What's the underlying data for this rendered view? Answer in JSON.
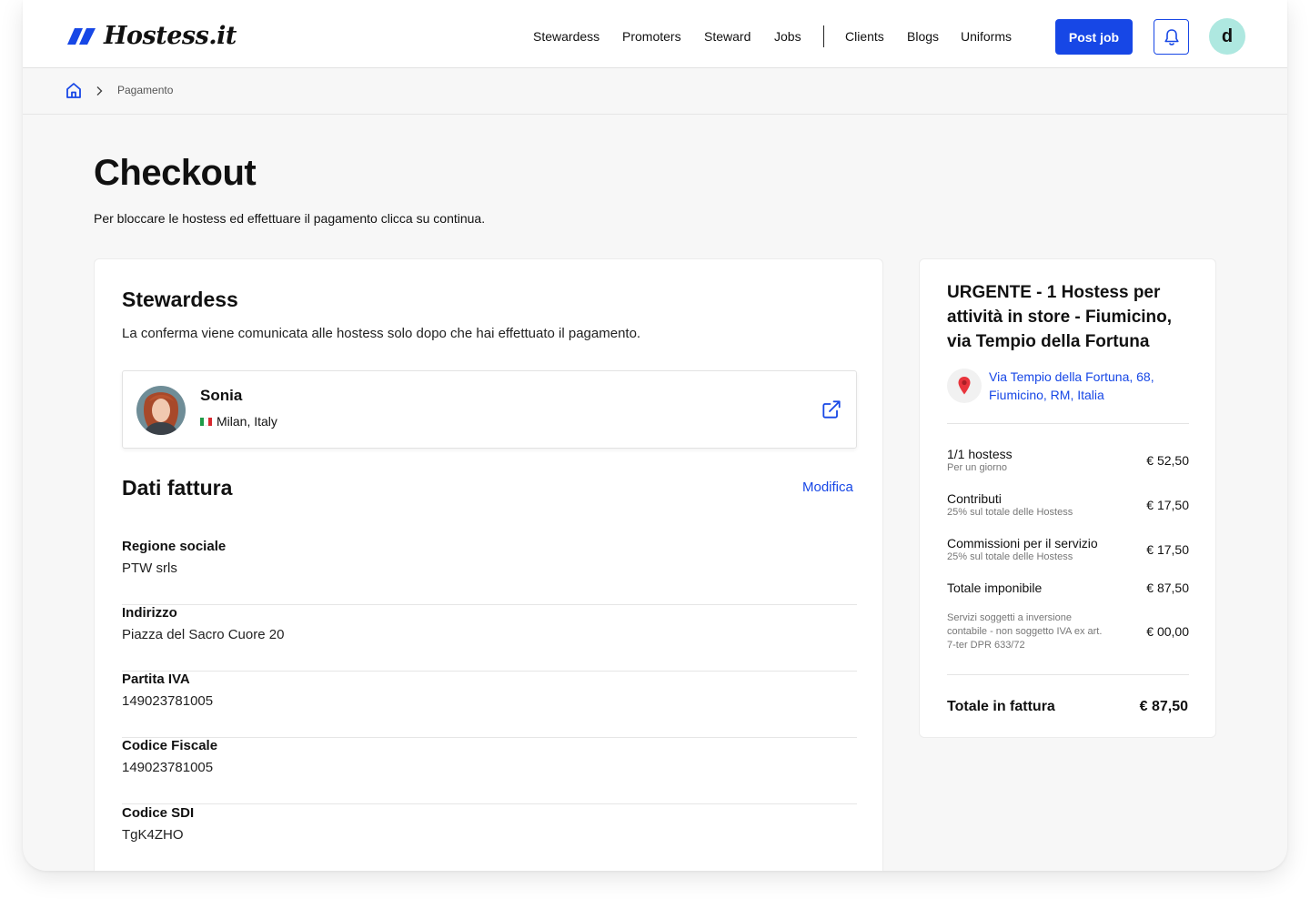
{
  "header": {
    "logo_text": "Hostess.it",
    "nav": [
      "Stewardess",
      "Promoters",
      "Steward",
      "Jobs",
      "Clients",
      "Blogs",
      "Uniforms"
    ],
    "post_job_label": "Post job",
    "avatar_initial": "d",
    "accent_color": "#1747e6"
  },
  "breadcrumb": {
    "current": "Pagamento"
  },
  "page": {
    "title": "Checkout",
    "subtitle": "Per bloccare le hostess ed effettuare il pagamento clicca su continua."
  },
  "stewardess": {
    "title": "Stewardess",
    "description": "La conferma viene comunicata alle hostess solo dopo che hai effettuato il pagamento.",
    "person": {
      "name": "Sonia",
      "location": "Milan, Italy"
    }
  },
  "invoice": {
    "title": "Dati fattura",
    "edit_label": "Modifica",
    "fields": [
      {
        "label": "Regione sociale",
        "value": "PTW srls"
      },
      {
        "label": "Indirizzo",
        "value": "Piazza del Sacro Cuore 20"
      },
      {
        "label": "Partita IVA",
        "value": "149023781005"
      },
      {
        "label": "Codice Fiscale",
        "value": "149023781005"
      },
      {
        "label": "Codice SDI",
        "value": "TgK4ZHO"
      }
    ]
  },
  "summary": {
    "title": "URGENTE - 1 Hostess per attività in store - Fiumicino, via Tempio della Fortuna",
    "address": "Via Tempio della Fortuna, 68, Fiumicino, RM, Italia",
    "lines": [
      {
        "label": "1/1 hostess",
        "sub": "Per un giorno",
        "price": "€ 52,50"
      },
      {
        "label": "Contributi",
        "sub": "25% sul totale delle Hostess",
        "price": "€ 17,50"
      },
      {
        "label": "Commissioni per il servizio",
        "sub": "25% sul totale delle Hostess",
        "price": "€ 17,50"
      },
      {
        "label": "Totale imponibile",
        "sub": "",
        "price": "€ 87,50"
      }
    ],
    "reverse_charge_note": "Servizi soggetti a inversione contabile - non soggetto IVA ex art. 7-ter DPR 633/72",
    "reverse_charge_price": "€ 00,00",
    "total_label": "Totale in fattura",
    "total_price": "€ 87,50"
  }
}
